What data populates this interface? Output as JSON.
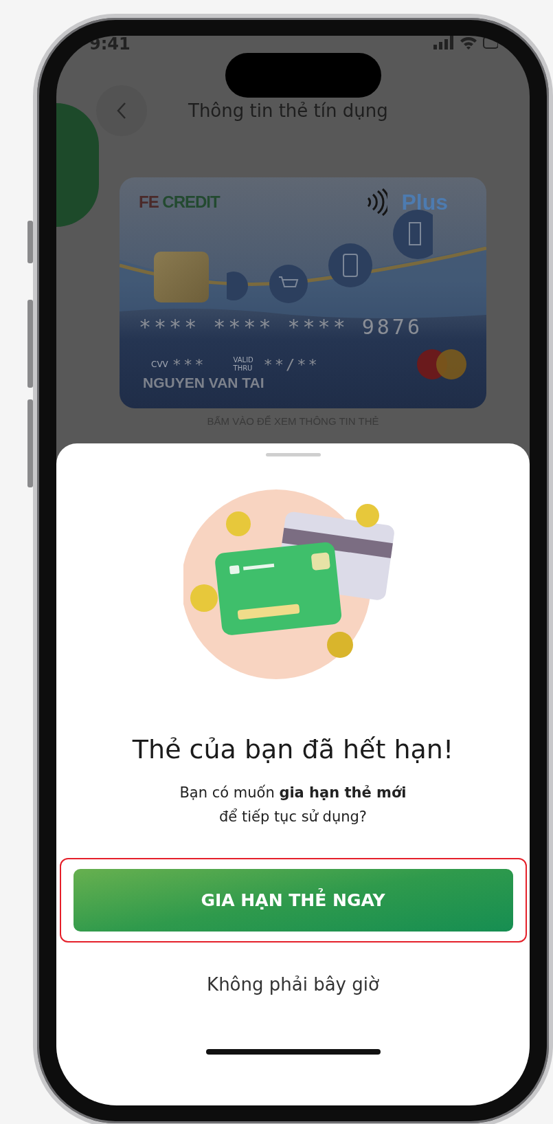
{
  "status_bar": {
    "time": "9:41"
  },
  "header": {
    "title": "Thông tin thẻ tín dụng"
  },
  "card": {
    "brand": [
      "FE",
      "CREDIT"
    ],
    "tier": "Plus",
    "number": [
      "****",
      "****",
      "****",
      "9876"
    ],
    "cvv_label": "CVV",
    "cvv": "***",
    "valid_label": "VALID THRU",
    "expiry": "**/**",
    "holder": "NGUYEN VAN TAI"
  },
  "card_hint": "BẤM VÀO ĐỂ XEM THÔNG TIN THẺ",
  "sheet": {
    "title": "Thẻ của bạn đã hết hạn!",
    "message": "Bạn có muốn **gia hạn thẻ mới**\nđể tiếp tục sử dụng?",
    "primary_button": {
      "label": "GIA HẠN THẺ NGAY",
      "highlighted": true
    },
    "secondary_button": "Không phải bây giờ"
  }
}
